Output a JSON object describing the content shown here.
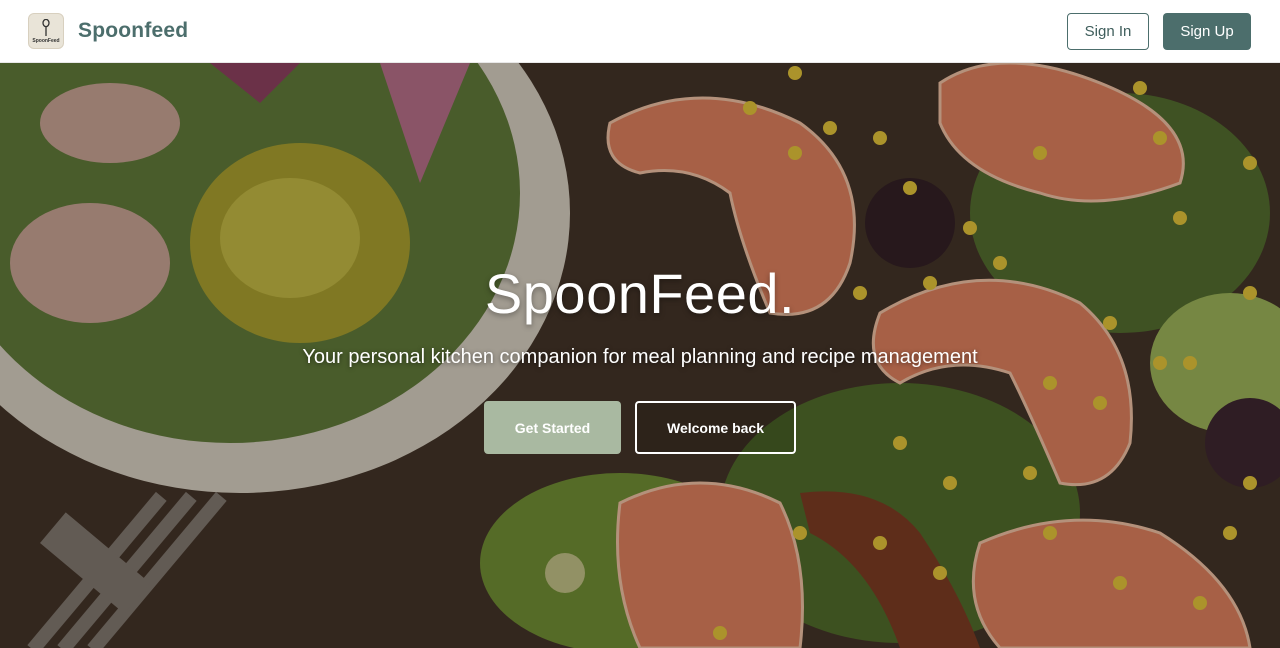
{
  "brand": {
    "name": "Spoonfeed",
    "logo_text": "SpoonFeed",
    "logo_icon": "spoon-icon"
  },
  "nav": {
    "sign_in_label": "Sign In",
    "sign_up_label": "Sign Up"
  },
  "hero": {
    "title": "SpoonFeed.",
    "subtitle": "Your personal kitchen companion for meal planning and recipe management",
    "get_started_label": "Get Started",
    "welcome_back_label": "Welcome back",
    "background_image": "food-illustration-shrimp-salad"
  },
  "colors": {
    "brand": "#4c6e6c",
    "get_started_bg": "#a9b9a1",
    "hero_bg": "#3d3026"
  }
}
